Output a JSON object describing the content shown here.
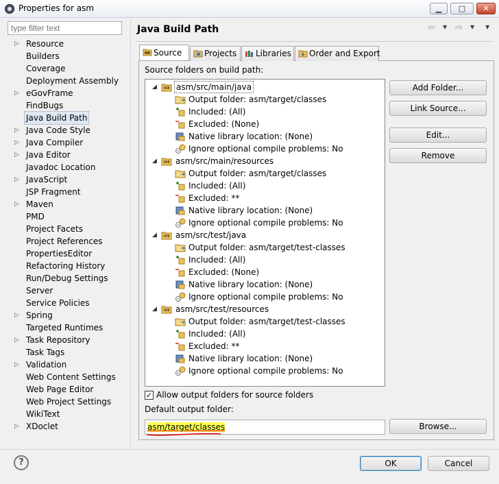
{
  "window": {
    "title": "Properties for asm",
    "controls": [
      "minimize",
      "maximize",
      "close"
    ]
  },
  "filter": {
    "placeholder": "type filter text"
  },
  "nav": {
    "items": [
      {
        "label": "Resource",
        "expandable": true
      },
      {
        "label": "Builders",
        "expandable": false
      },
      {
        "label": "Coverage",
        "expandable": false
      },
      {
        "label": "Deployment Assembly",
        "expandable": false
      },
      {
        "label": "eGovFrame",
        "expandable": true
      },
      {
        "label": "FindBugs",
        "expandable": false
      },
      {
        "label": "Java Build Path",
        "expandable": false,
        "selected": true
      },
      {
        "label": "Java Code Style",
        "expandable": true
      },
      {
        "label": "Java Compiler",
        "expandable": true
      },
      {
        "label": "Java Editor",
        "expandable": true
      },
      {
        "label": "Javadoc Location",
        "expandable": false
      },
      {
        "label": "JavaScript",
        "expandable": true
      },
      {
        "label": "JSP Fragment",
        "expandable": false
      },
      {
        "label": "Maven",
        "expandable": true
      },
      {
        "label": "PMD",
        "expandable": false
      },
      {
        "label": "Project Facets",
        "expandable": false
      },
      {
        "label": "Project References",
        "expandable": false
      },
      {
        "label": "PropertiesEditor",
        "expandable": false
      },
      {
        "label": "Refactoring History",
        "expandable": false
      },
      {
        "label": "Run/Debug Settings",
        "expandable": false
      },
      {
        "label": "Server",
        "expandable": false
      },
      {
        "label": "Service Policies",
        "expandable": false
      },
      {
        "label": "Spring",
        "expandable": true
      },
      {
        "label": "Targeted Runtimes",
        "expandable": false
      },
      {
        "label": "Task Repository",
        "expandable": true
      },
      {
        "label": "Task Tags",
        "expandable": false
      },
      {
        "label": "Validation",
        "expandable": true
      },
      {
        "label": "Web Content Settings",
        "expandable": false
      },
      {
        "label": "Web Page Editor",
        "expandable": false
      },
      {
        "label": "Web Project Settings",
        "expandable": false
      },
      {
        "label": "WikiText",
        "expandable": false
      },
      {
        "label": "XDoclet",
        "expandable": true
      }
    ]
  },
  "page": {
    "title": "Java Build Path",
    "tabs": [
      {
        "label": "Source",
        "icon": "source-folder-icon",
        "active": true
      },
      {
        "label": "Projects",
        "icon": "projects-icon"
      },
      {
        "label": "Libraries",
        "icon": "libraries-icon"
      },
      {
        "label": "Order and Export",
        "icon": "order-export-icon"
      }
    ],
    "source_label": "Source folders on build path:",
    "source_folders": [
      {
        "name": "asm/src/main/java",
        "children": [
          {
            "icon": "output-folder-icon",
            "text": "Output folder: asm/target/classes"
          },
          {
            "icon": "included-icon",
            "text": "Included: (All)"
          },
          {
            "icon": "excluded-icon",
            "text": "Excluded: (None)"
          },
          {
            "icon": "native-library-icon",
            "text": "Native library location: (None)"
          },
          {
            "icon": "ignore-problems-icon",
            "text": "Ignore optional compile problems: No"
          }
        ]
      },
      {
        "name": "asm/src/main/resources",
        "children": [
          {
            "icon": "output-folder-icon",
            "text": "Output folder: asm/target/classes"
          },
          {
            "icon": "included-icon",
            "text": "Included: (All)"
          },
          {
            "icon": "excluded-icon",
            "text": "Excluded: **"
          },
          {
            "icon": "native-library-icon",
            "text": "Native library location: (None)"
          },
          {
            "icon": "ignore-problems-icon",
            "text": "Ignore optional compile problems: No"
          }
        ]
      },
      {
        "name": "asm/src/test/java",
        "children": [
          {
            "icon": "output-folder-icon",
            "text": "Output folder: asm/target/test-classes"
          },
          {
            "icon": "included-icon",
            "text": "Included: (All)"
          },
          {
            "icon": "excluded-icon",
            "text": "Excluded: (None)"
          },
          {
            "icon": "native-library-icon",
            "text": "Native library location: (None)"
          },
          {
            "icon": "ignore-problems-icon",
            "text": "Ignore optional compile problems: No"
          }
        ]
      },
      {
        "name": "asm/src/test/resources",
        "children": [
          {
            "icon": "output-folder-icon",
            "text": "Output folder: asm/target/test-classes"
          },
          {
            "icon": "included-icon",
            "text": "Included: (All)"
          },
          {
            "icon": "excluded-icon",
            "text": "Excluded: **"
          },
          {
            "icon": "native-library-icon",
            "text": "Native library location: (None)"
          },
          {
            "icon": "ignore-problems-icon",
            "text": "Ignore optional compile problems: No"
          }
        ]
      }
    ],
    "buttons": {
      "add_folder": "Add Folder...",
      "link_source": "Link Source...",
      "edit": "Edit...",
      "remove": "Remove",
      "browse": "Browse..."
    },
    "allow_output_folders": {
      "label": "Allow output folders for source folders",
      "checked": true
    },
    "default_output_label": "Default output folder:",
    "default_output_value": "asm/target/classes"
  },
  "footer": {
    "ok": "OK",
    "cancel": "Cancel"
  },
  "colors": {
    "highlight": "#ffff52",
    "underline": "#dd0000",
    "selection": "#dde8f3"
  }
}
